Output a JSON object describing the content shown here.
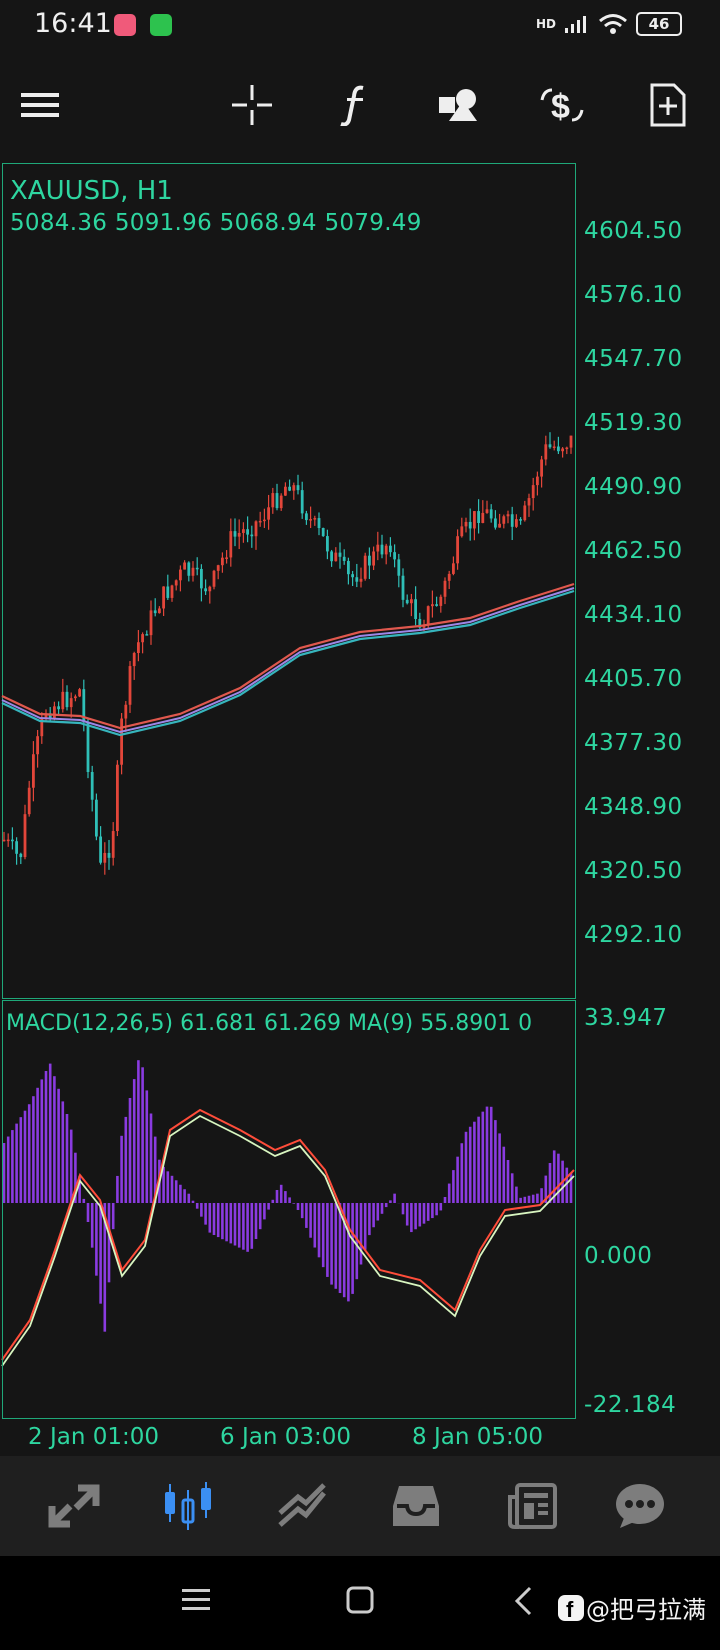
{
  "status": {
    "time": "16:41",
    "network": "HD",
    "battery": "46"
  },
  "toolbar": {
    "items": [
      {
        "name": "menu-icon"
      },
      {
        "name": "crosshair-icon"
      },
      {
        "name": "indicator-icon"
      },
      {
        "name": "objects-icon"
      },
      {
        "name": "symbol-icon"
      },
      {
        "name": "new-order-icon"
      }
    ]
  },
  "chart": {
    "symbol": "XAUUSD, H1",
    "ohlc": "5084.36 5091.96 5068.94 5079.49",
    "price_axis": [
      "4604.50",
      "4576.10",
      "4547.70",
      "4519.30",
      "4490.90",
      "4462.50",
      "4434.10",
      "4405.70",
      "4377.30",
      "4348.90",
      "4320.50",
      "4292.10"
    ],
    "macd_label": "MACD(12,26,5) 61.681 61.269 MA(9) 55.8901 0",
    "macd_axis": [
      "33.947",
      "0.000",
      "-22.184"
    ],
    "time_axis": [
      "2 Jan 01:00",
      "6 Jan 03:00",
      "8 Jan 05:00"
    ],
    "colors": {
      "bull": "#e2463a",
      "bear": "#2fbfb7",
      "accent": "#2ed6a0",
      "macd_hist": "#8a3be0"
    }
  },
  "nav": {
    "items": [
      {
        "name": "quotes-tab"
      },
      {
        "name": "chart-tab",
        "active": true
      },
      {
        "name": "trade-tab"
      },
      {
        "name": "history-tab"
      },
      {
        "name": "news-tab"
      },
      {
        "name": "chat-tab"
      }
    ]
  },
  "watermark": "@把弓拉满"
}
